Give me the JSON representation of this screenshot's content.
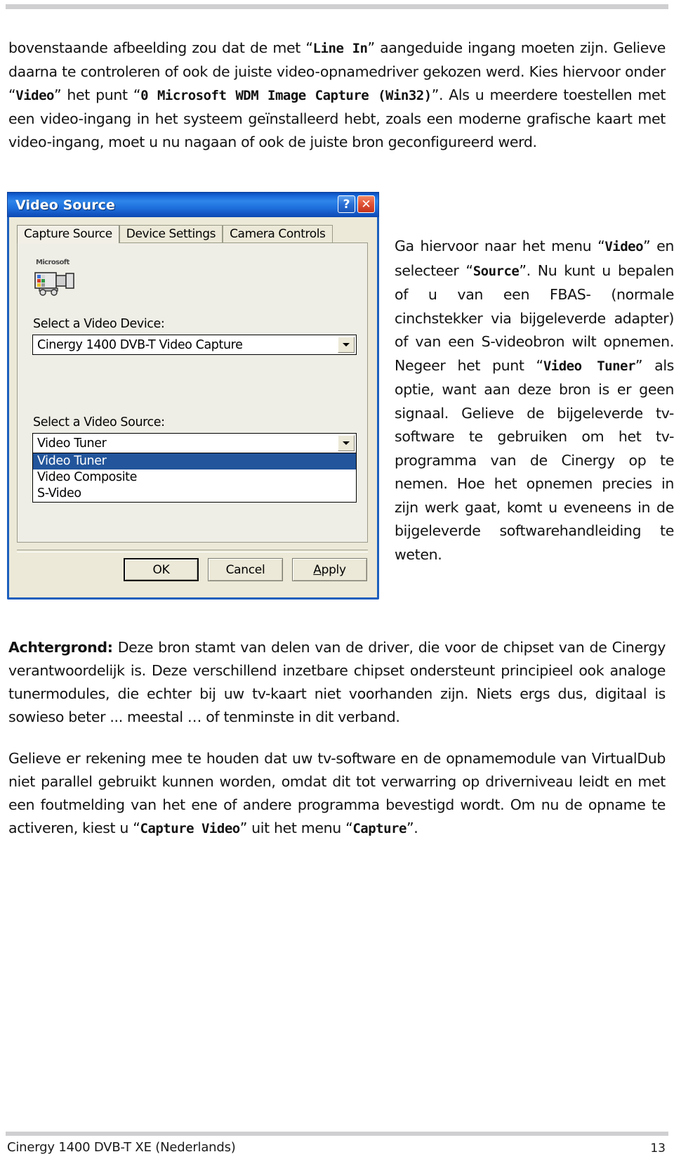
{
  "page": {
    "footer_left": "Cinergy 1400 DVB-T XE (Nederlands)",
    "footer_page": "13"
  },
  "paragraphs": {
    "intro_1": "bovenstaande afbeelding zou dat de met ",
    "intro_code_1": "Line In",
    "intro_2": "” aangeduide ingang moeten zijn. Gelieve daarna te controleren of ook de juiste video-opnamedriver gekozen werd. Kies hiervoor onder “",
    "intro_code_2": "Video",
    "intro_3": "” het punt “",
    "intro_code_3": "0 Microsoft WDM Image Capture (Win32)",
    "intro_4": "”. Als u meerdere toestellen met een video-ingang in het systeem geïnstalleerd hebt, zoals een moderne grafische kaart met video-ingang, moet u nu nagaan of ook de juiste bron geconfigureerd werd.",
    "side_1": "Ga hiervoor naar het menu “",
    "side_code_1": "Video",
    "side_2": "” en selecteer “",
    "side_code_2": "Source",
    "side_3": "”. Nu kunt u bepalen of u van een FBAS- (normale cinchstekker via bijgeleverde adapter) of van een S-videobron wilt opnemen. Negeer het punt “",
    "side_code_3": "Video Tuner",
    "side_4": "” als optie, want aan deze bron is er geen signaal. Gelieve de bijgeleverde tv-software te gebruiken om het tv-programma van de Cinergy op te nemen. Hoe het opnemen precies in zijn werk gaat, komt u eveneens in de bijgeleverde softwarehandleiding te weten.",
    "background_label": "Achtergrond:",
    "background_body": " Deze bron stamt van delen van de driver, die voor de chipset van de Cinergy verantwoordelijk is. Deze verschillend inzetbare chipset ondersteunt principieel ook analoge tunermodules, die echter bij uw tv-kaart niet voorhanden zijn. Niets ergs dus, digitaal is sowieso beter ... meestal … of tenminste in dit verband.",
    "final_1": "Gelieve er rekening mee te houden dat uw tv-software en de opnamemodule van VirtualDub niet parallel gebruikt kunnen worden, omdat dit tot verwarring op driverniveau leidt en met een foutmelding van het ene of andere programma bevestigd wordt. Om nu de opname te activeren, kiest u “",
    "final_code_1": "Capture Video",
    "final_2": "” uit het menu “",
    "final_code_2": "Capture",
    "final_3": "”."
  },
  "dialog": {
    "title": "Video Source",
    "caption_buttons": {
      "help": "?",
      "close": "✕"
    },
    "tabs": [
      {
        "label": "Capture Source",
        "active": true
      },
      {
        "label": "Device Settings",
        "active": false
      },
      {
        "label": "Camera Controls",
        "active": false
      }
    ],
    "icon_caption": "Microsoft",
    "device": {
      "label": "Select a Video Device:",
      "value": "Cinergy 1400 DVB-T Video Capture"
    },
    "source": {
      "label": "Select a Video Source:",
      "value": "Video Tuner",
      "options": [
        {
          "label": "Video Tuner",
          "selected": true
        },
        {
          "label": "Video Composite",
          "selected": false
        },
        {
          "label": "S-Video",
          "selected": false
        }
      ]
    },
    "buttons": {
      "ok": "OK",
      "cancel": "Cancel",
      "apply_prefix": "A",
      "apply_rest": "pply"
    },
    "colors": {
      "titlebar_blue": "#1765d8",
      "selection_blue": "#22559b",
      "face": "#ece9d8",
      "close_red": "#e2563a"
    }
  }
}
